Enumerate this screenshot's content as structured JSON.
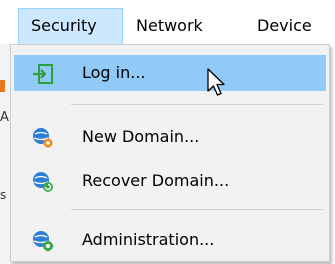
{
  "menubar": {
    "items": [
      {
        "label": "Security",
        "state": "open"
      },
      {
        "label": "Network"
      },
      {
        "label": "Device"
      }
    ]
  },
  "dropdown": {
    "items": [
      {
        "label": "Log in...",
        "icon": "login-icon",
        "state": "hovered"
      },
      {
        "label": "New Domain...",
        "icon": "new-domain-icon"
      },
      {
        "label": "Recover Domain...",
        "icon": "recover-domain-icon"
      },
      {
        "label": "Administration...",
        "icon": "administration-icon"
      }
    ]
  },
  "background_fragments": {
    "mark_a": "A",
    "mark_s": "s"
  },
  "colors": {
    "menubar_active_bg": "#cce8ff",
    "menu_highlight_bg": "#91c9f7",
    "login_icon_green": "#2e9e3e",
    "domain_icon_blue": "#2b7fd8",
    "new_badge_orange": "#f28a1c",
    "recover_badge_green": "#3aa84a"
  },
  "cursor": "arrow-cursor-icon"
}
